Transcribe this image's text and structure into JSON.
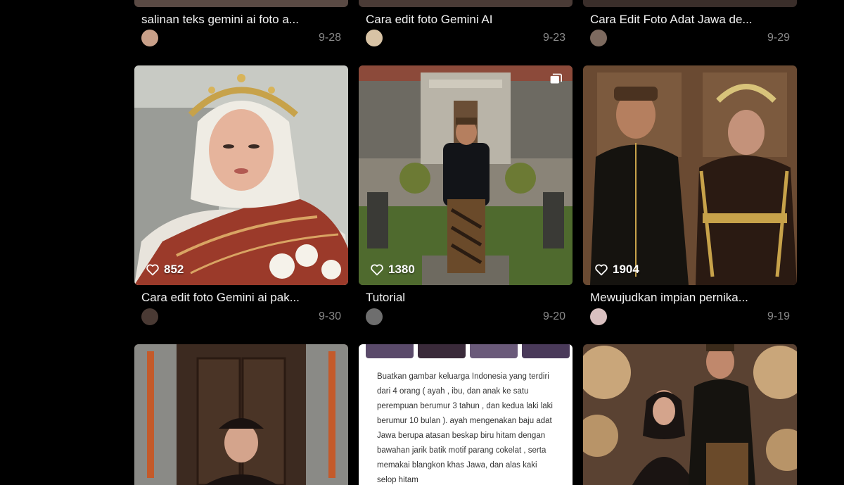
{
  "feed": {
    "top_row": [
      {
        "title": "salinan teks gemini ai foto a...",
        "date": "9-28"
      },
      {
        "title": "Cara edit foto Gemini AI",
        "date": "9-23"
      },
      {
        "title": "Cara Edit Foto Adat Jawa de...",
        "date": "9-29"
      }
    ],
    "middle_row": [
      {
        "title": "Cara edit foto Gemini ai pak...",
        "date": "9-30",
        "likes": "852"
      },
      {
        "title": "Tutorial",
        "date": "9-20",
        "likes": "1380"
      },
      {
        "title": "Mewujudkan impian pernika...",
        "date": "9-19",
        "likes": "1904"
      }
    ],
    "bottom_row": {
      "text_card": "Buatkan gambar keluarga Indonesia yang terdiri dari 4 orang ( ayah , ibu, dan anak ke satu perempuan berumur 3 tahun , dan kedua laki laki berumur 10 bulan ). ayah mengenakan baju adat Jawa berupa atasan beskap biru hitam dengan bawahan jarik batik motif parang cokelat , serta memakai blangkon khas Jawa, dan alas kaki selop hitam"
    }
  },
  "colors": {
    "background": "#000000",
    "title_text": "#f2f2f2",
    "date_text": "#8a8a8a"
  },
  "icons": {
    "likes": "heart-outline-icon",
    "multi_image": "image-stack-icon"
  }
}
